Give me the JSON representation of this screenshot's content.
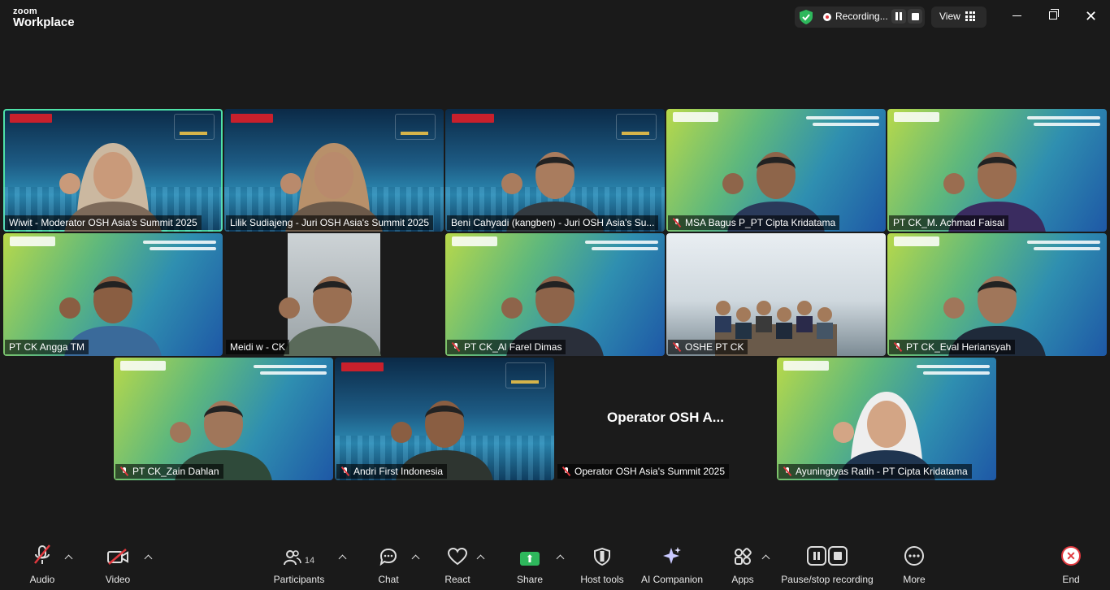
{
  "app": {
    "brand_top": "zoom",
    "brand_name": "Workplace"
  },
  "topbar": {
    "recording_label": "Recording...",
    "view_label": "View"
  },
  "participants": [
    {
      "name": "Wiwit  - Moderator OSH Asia's Summit 2025",
      "muted": false,
      "active": true,
      "background": "osh"
    },
    {
      "name": "Lilik Sudiajeng - Juri OSH Asia's Summit 2025",
      "muted": false,
      "active": false,
      "background": "osh"
    },
    {
      "name": "Beni Cahyadi (kangben) - Juri OSH Asia's Su...",
      "muted": false,
      "active": false,
      "background": "osh"
    },
    {
      "name": "MSA Bagus P_PT Cipta Kridatama",
      "muted": true,
      "active": false,
      "background": "award"
    },
    {
      "name": "PT CK_M. Achmad Faisal",
      "muted": false,
      "active": false,
      "background": "award"
    },
    {
      "name": "PT CK Angga TM",
      "muted": false,
      "active": false,
      "background": "award"
    },
    {
      "name": "Meidi w - CK",
      "muted": false,
      "active": false,
      "background": "camera"
    },
    {
      "name": "PT CK_Al Farel Dimas",
      "muted": true,
      "active": false,
      "background": "award"
    },
    {
      "name": "OSHE PT CK",
      "muted": true,
      "active": false,
      "background": "room"
    },
    {
      "name": "PT CK_Eval Heriansyah",
      "muted": true,
      "active": false,
      "background": "award"
    },
    {
      "name": "PT CK_Zain Dahlan",
      "muted": true,
      "active": false,
      "background": "award"
    },
    {
      "name": "Andri First Indonesia",
      "muted": true,
      "active": false,
      "background": "osh"
    },
    {
      "name": "Operator OSH Asia's Summit 2025",
      "muted": true,
      "active": false,
      "background": "none",
      "display_name": "Operator OSH A..."
    },
    {
      "name": "Ayuningtyas Ratih - PT Cipta Kridatama",
      "muted": true,
      "active": false,
      "background": "award"
    }
  ],
  "toolbar": {
    "audio": "Audio",
    "video": "Video",
    "participants": "Participants",
    "participants_count": "14",
    "chat": "Chat",
    "react": "React",
    "share": "Share",
    "host_tools": "Host tools",
    "ai_companion": "AI Companion",
    "apps": "Apps",
    "pause_stop": "Pause/stop recording",
    "more": "More",
    "end": "End"
  },
  "colors": {
    "active_speaker": "#4ee1a8",
    "recording": "#e0383e",
    "share": "#2eb85c",
    "muted": "#e0383e"
  }
}
